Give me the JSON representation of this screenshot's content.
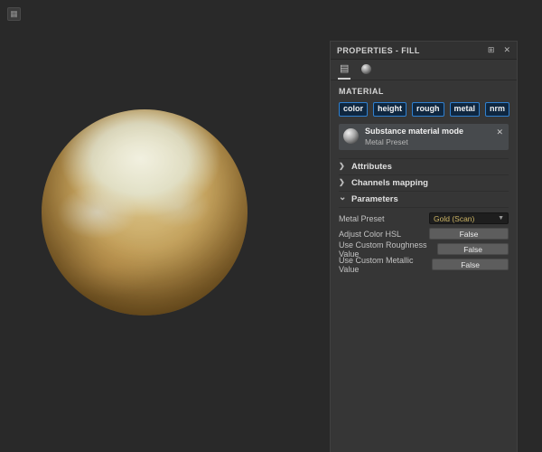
{
  "panel": {
    "title": "PROPERTIES - FILL",
    "material": {
      "label": "MATERIAL",
      "channels": [
        "color",
        "height",
        "rough",
        "metal",
        "nrm"
      ],
      "mode": {
        "title": "Substance material mode",
        "subtitle": "Metal Preset"
      }
    },
    "sections": {
      "attributes": "Attributes",
      "channels_mapping": "Channels mapping",
      "parameters": "Parameters"
    },
    "parameters": {
      "rows": [
        {
          "label": "Metal Preset",
          "control": "dropdown",
          "value": "Gold (Scan)"
        },
        {
          "label": "Adjust Color HSL",
          "control": "button",
          "value": "False"
        },
        {
          "label": "Use Custom Roughness Value",
          "control": "button",
          "value": "False"
        },
        {
          "label": "Use Custom Metallic Value",
          "control": "button",
          "value": "False"
        }
      ]
    }
  },
  "icons": {
    "close": "✕",
    "dock": "⊞",
    "widget": "▦",
    "form": "▤",
    "chevron_right": "❯",
    "chevron_down": "⌄",
    "dropdown_arrow": "▼"
  },
  "colors": {
    "accent_blue": "#2f80d0",
    "panel_background": "#363636",
    "viewport_background": "#292929",
    "gold_value_text": "#cdb564",
    "sphere_gold": "#c8a660"
  }
}
